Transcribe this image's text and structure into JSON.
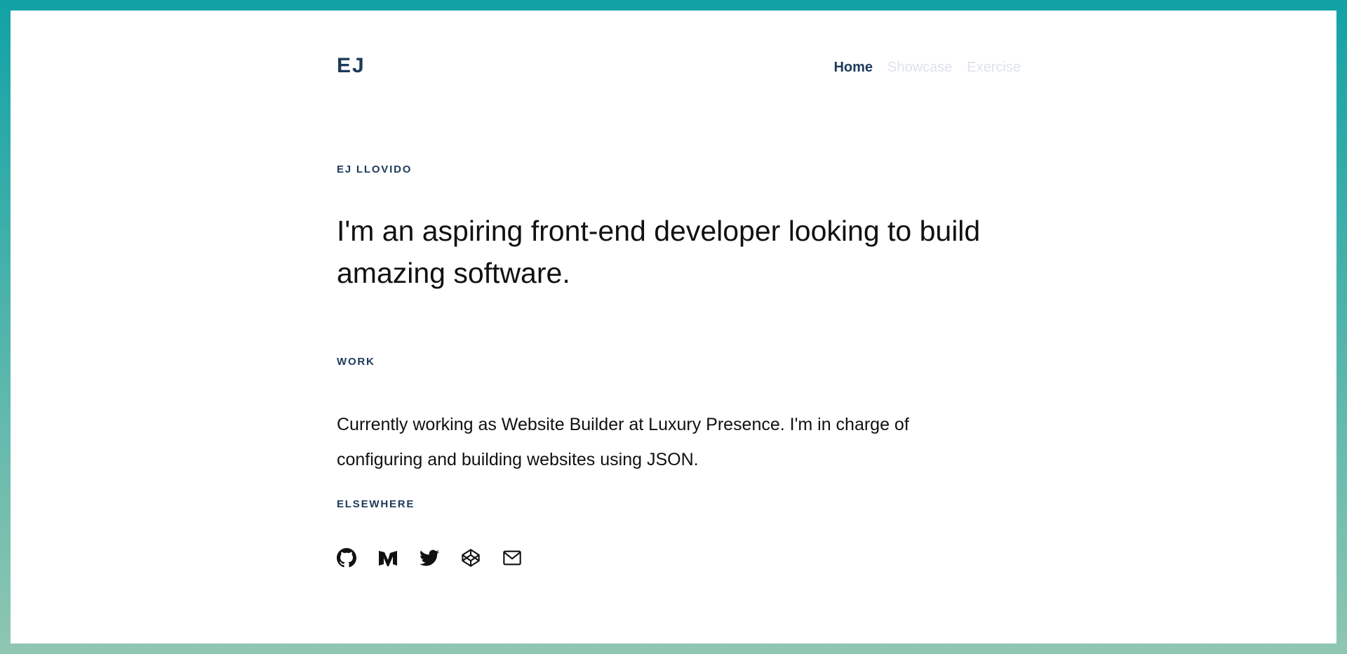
{
  "header": {
    "logo": "EJ",
    "nav": [
      {
        "label": "Home",
        "active": true
      },
      {
        "label": "Showcase",
        "active": false
      },
      {
        "label": "Exercise",
        "active": false
      }
    ]
  },
  "intro": {
    "eyebrow": "EJ LLOVIDO",
    "headline": "I'm an aspiring front-end developer looking to build amazing software."
  },
  "work": {
    "eyebrow": "WORK",
    "text": "Currently working as Website Builder at Luxury Presence. I'm in charge of configuring and building websites using JSON."
  },
  "elsewhere": {
    "eyebrow": "ELSEWHERE",
    "links": [
      {
        "icon": "github-icon"
      },
      {
        "icon": "medium-icon"
      },
      {
        "icon": "twitter-icon"
      },
      {
        "icon": "codepen-icon"
      },
      {
        "icon": "mail-icon"
      }
    ]
  },
  "colors": {
    "accent": "#1d3a5a",
    "nav_inactive": "#dde3ea",
    "frame_top": "#11a2a6",
    "frame_bottom": "#8fc6b1"
  }
}
